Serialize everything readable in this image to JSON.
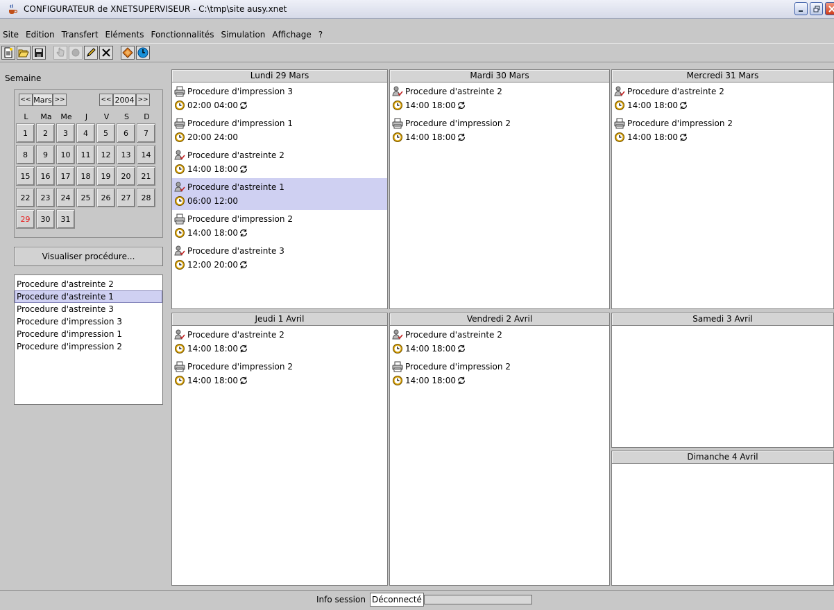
{
  "window": {
    "title": "CONFIGURATEUR de XNETSUPERVISEUR - C:\\tmp\\site ausy.xnet"
  },
  "menu": [
    "Site",
    "Edition",
    "Transfert",
    "Eléments",
    "Fonctionnalités",
    "Simulation",
    "Affichage",
    "?"
  ],
  "toolbar": {
    "buttons": [
      {
        "icon": "new-file-icon",
        "enabled": true
      },
      {
        "icon": "open-folder-icon",
        "enabled": true
      },
      {
        "icon": "save-icon",
        "enabled": true
      },
      {
        "icon": "hand-pointer-icon",
        "enabled": false
      },
      {
        "icon": "circle-icon",
        "enabled": false
      },
      {
        "icon": "pencil-icon",
        "enabled": true
      },
      {
        "icon": "delete-x-icon",
        "enabled": true
      },
      {
        "icon": "diamond-icon",
        "enabled": true
      },
      {
        "icon": "clock-icon",
        "enabled": true
      }
    ]
  },
  "sidebar": {
    "semaine_label": "Semaine",
    "calendar": {
      "prev_month": "<<",
      "month": "Mars",
      "next_month": ">>",
      "prev_year": "<<",
      "year": "2004",
      "next_year": ">>",
      "weekdays": [
        "L",
        "Ma",
        "Me",
        "J",
        "V",
        "S",
        "D"
      ],
      "days": [
        "1",
        "2",
        "3",
        "4",
        "5",
        "6",
        "7",
        "8",
        "9",
        "10",
        "11",
        "12",
        "13",
        "14",
        "15",
        "16",
        "17",
        "18",
        "19",
        "20",
        "21",
        "22",
        "23",
        "24",
        "25",
        "26",
        "27",
        "28",
        "29",
        "30",
        "31"
      ],
      "selected_day": "29"
    },
    "visualiser_label": "Visualiser procédure...",
    "procedures": [
      "Procedure d'astreinte 2",
      "Procedure d'astreinte 1",
      "Procedure d'astreinte 3",
      "Procedure d'impression 3",
      "Procedure d'impression 1",
      "Procedure d'impression 2"
    ],
    "selected_procedure": "Procedure d'astreinte 1"
  },
  "week": {
    "days": [
      {
        "title": "Lundi 29 Mars",
        "entries": [
          {
            "type": "impression",
            "name": "Procedure d'impression 3",
            "time": "02:00 04:00",
            "repeat": true,
            "selected": false
          },
          {
            "type": "impression",
            "name": "Procedure d'impression 1",
            "time": "20:00 24:00",
            "repeat": false,
            "selected": false
          },
          {
            "type": "astreinte",
            "name": "Procedure d'astreinte 2",
            "time": "14:00 18:00",
            "repeat": true,
            "selected": false
          },
          {
            "type": "astreinte",
            "name": "Procedure d'astreinte 1",
            "time": "06:00 12:00",
            "repeat": false,
            "selected": true
          },
          {
            "type": "impression",
            "name": "Procedure d'impression 2",
            "time": "14:00 18:00",
            "repeat": true,
            "selected": false
          },
          {
            "type": "astreinte",
            "name": "Procedure d'astreinte 3",
            "time": "12:00 20:00",
            "repeat": true,
            "selected": false
          }
        ]
      },
      {
        "title": "Mardi 30 Mars",
        "entries": [
          {
            "type": "astreinte",
            "name": "Procedure d'astreinte 2",
            "time": "14:00 18:00",
            "repeat": true,
            "selected": false
          },
          {
            "type": "impression",
            "name": "Procedure d'impression 2",
            "time": "14:00 18:00",
            "repeat": true,
            "selected": false
          }
        ]
      },
      {
        "title": "Mercredi 31 Mars",
        "entries": [
          {
            "type": "astreinte",
            "name": "Procedure d'astreinte 2",
            "time": "14:00 18:00",
            "repeat": true,
            "selected": false
          },
          {
            "type": "impression",
            "name": "Procedure d'impression 2",
            "time": "14:00 18:00",
            "repeat": true,
            "selected": false
          }
        ]
      },
      {
        "title": "Jeudi 1 Avril",
        "entries": [
          {
            "type": "astreinte",
            "name": "Procedure d'astreinte 2",
            "time": "14:00 18:00",
            "repeat": true,
            "selected": false
          },
          {
            "type": "impression",
            "name": "Procedure d'impression 2",
            "time": "14:00 18:00",
            "repeat": true,
            "selected": false
          }
        ]
      },
      {
        "title": "Vendredi 2 Avril",
        "entries": [
          {
            "type": "astreinte",
            "name": "Procedure d'astreinte 2",
            "time": "14:00 18:00",
            "repeat": true,
            "selected": false
          },
          {
            "type": "impression",
            "name": "Procedure d'impression 2",
            "time": "14:00 18:00",
            "repeat": true,
            "selected": false
          }
        ]
      },
      {
        "title": "Samedi 3 Avril",
        "entries": []
      },
      {
        "title": "Dimanche 4 Avril",
        "entries": []
      }
    ]
  },
  "status": {
    "label": "Info session",
    "value": "Déconnecté",
    "progress": 0
  },
  "colors": {
    "background": "#c8c8c8",
    "selection": "#cfd0f2",
    "today": "#e82020",
    "clock": "#d8a000"
  }
}
